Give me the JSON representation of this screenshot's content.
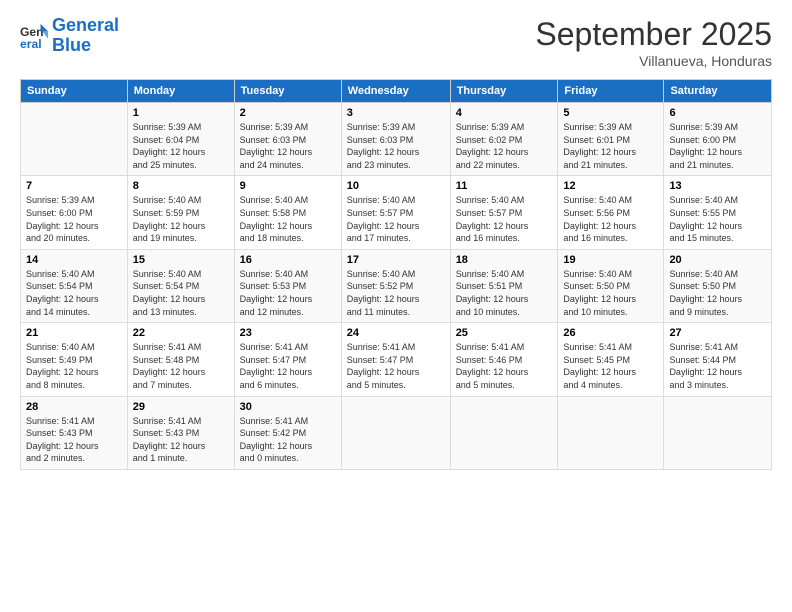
{
  "header": {
    "logo_line1": "General",
    "logo_line2": "Blue",
    "month": "September 2025",
    "location": "Villanueva, Honduras"
  },
  "days_of_week": [
    "Sunday",
    "Monday",
    "Tuesday",
    "Wednesday",
    "Thursday",
    "Friday",
    "Saturday"
  ],
  "weeks": [
    [
      {
        "day": "",
        "info": ""
      },
      {
        "day": "1",
        "info": "Sunrise: 5:39 AM\nSunset: 6:04 PM\nDaylight: 12 hours\nand 25 minutes."
      },
      {
        "day": "2",
        "info": "Sunrise: 5:39 AM\nSunset: 6:03 PM\nDaylight: 12 hours\nand 24 minutes."
      },
      {
        "day": "3",
        "info": "Sunrise: 5:39 AM\nSunset: 6:03 PM\nDaylight: 12 hours\nand 23 minutes."
      },
      {
        "day": "4",
        "info": "Sunrise: 5:39 AM\nSunset: 6:02 PM\nDaylight: 12 hours\nand 22 minutes."
      },
      {
        "day": "5",
        "info": "Sunrise: 5:39 AM\nSunset: 6:01 PM\nDaylight: 12 hours\nand 21 minutes."
      },
      {
        "day": "6",
        "info": "Sunrise: 5:39 AM\nSunset: 6:00 PM\nDaylight: 12 hours\nand 21 minutes."
      }
    ],
    [
      {
        "day": "7",
        "info": "Sunrise: 5:39 AM\nSunset: 6:00 PM\nDaylight: 12 hours\nand 20 minutes."
      },
      {
        "day": "8",
        "info": "Sunrise: 5:40 AM\nSunset: 5:59 PM\nDaylight: 12 hours\nand 19 minutes."
      },
      {
        "day": "9",
        "info": "Sunrise: 5:40 AM\nSunset: 5:58 PM\nDaylight: 12 hours\nand 18 minutes."
      },
      {
        "day": "10",
        "info": "Sunrise: 5:40 AM\nSunset: 5:57 PM\nDaylight: 12 hours\nand 17 minutes."
      },
      {
        "day": "11",
        "info": "Sunrise: 5:40 AM\nSunset: 5:57 PM\nDaylight: 12 hours\nand 16 minutes."
      },
      {
        "day": "12",
        "info": "Sunrise: 5:40 AM\nSunset: 5:56 PM\nDaylight: 12 hours\nand 16 minutes."
      },
      {
        "day": "13",
        "info": "Sunrise: 5:40 AM\nSunset: 5:55 PM\nDaylight: 12 hours\nand 15 minutes."
      }
    ],
    [
      {
        "day": "14",
        "info": "Sunrise: 5:40 AM\nSunset: 5:54 PM\nDaylight: 12 hours\nand 14 minutes."
      },
      {
        "day": "15",
        "info": "Sunrise: 5:40 AM\nSunset: 5:54 PM\nDaylight: 12 hours\nand 13 minutes."
      },
      {
        "day": "16",
        "info": "Sunrise: 5:40 AM\nSunset: 5:53 PM\nDaylight: 12 hours\nand 12 minutes."
      },
      {
        "day": "17",
        "info": "Sunrise: 5:40 AM\nSunset: 5:52 PM\nDaylight: 12 hours\nand 11 minutes."
      },
      {
        "day": "18",
        "info": "Sunrise: 5:40 AM\nSunset: 5:51 PM\nDaylight: 12 hours\nand 10 minutes."
      },
      {
        "day": "19",
        "info": "Sunrise: 5:40 AM\nSunset: 5:50 PM\nDaylight: 12 hours\nand 10 minutes."
      },
      {
        "day": "20",
        "info": "Sunrise: 5:40 AM\nSunset: 5:50 PM\nDaylight: 12 hours\nand 9 minutes."
      }
    ],
    [
      {
        "day": "21",
        "info": "Sunrise: 5:40 AM\nSunset: 5:49 PM\nDaylight: 12 hours\nand 8 minutes."
      },
      {
        "day": "22",
        "info": "Sunrise: 5:41 AM\nSunset: 5:48 PM\nDaylight: 12 hours\nand 7 minutes."
      },
      {
        "day": "23",
        "info": "Sunrise: 5:41 AM\nSunset: 5:47 PM\nDaylight: 12 hours\nand 6 minutes."
      },
      {
        "day": "24",
        "info": "Sunrise: 5:41 AM\nSunset: 5:47 PM\nDaylight: 12 hours\nand 5 minutes."
      },
      {
        "day": "25",
        "info": "Sunrise: 5:41 AM\nSunset: 5:46 PM\nDaylight: 12 hours\nand 5 minutes."
      },
      {
        "day": "26",
        "info": "Sunrise: 5:41 AM\nSunset: 5:45 PM\nDaylight: 12 hours\nand 4 minutes."
      },
      {
        "day": "27",
        "info": "Sunrise: 5:41 AM\nSunset: 5:44 PM\nDaylight: 12 hours\nand 3 minutes."
      }
    ],
    [
      {
        "day": "28",
        "info": "Sunrise: 5:41 AM\nSunset: 5:43 PM\nDaylight: 12 hours\nand 2 minutes."
      },
      {
        "day": "29",
        "info": "Sunrise: 5:41 AM\nSunset: 5:43 PM\nDaylight: 12 hours\nand 1 minute."
      },
      {
        "day": "30",
        "info": "Sunrise: 5:41 AM\nSunset: 5:42 PM\nDaylight: 12 hours\nand 0 minutes."
      },
      {
        "day": "",
        "info": ""
      },
      {
        "day": "",
        "info": ""
      },
      {
        "day": "",
        "info": ""
      },
      {
        "day": "",
        "info": ""
      }
    ]
  ]
}
